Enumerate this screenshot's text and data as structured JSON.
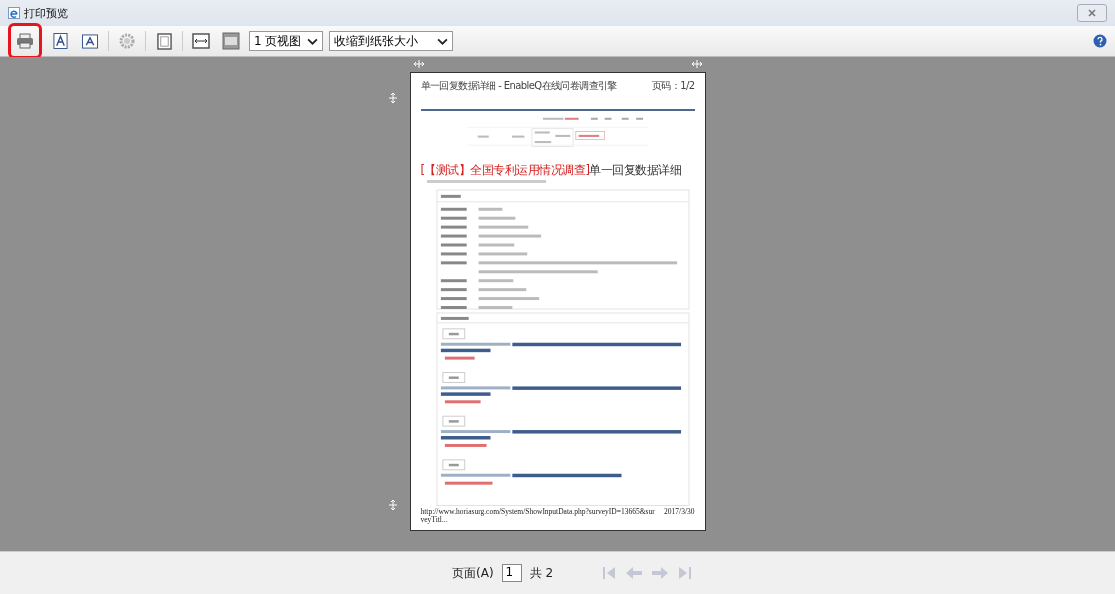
{
  "window": {
    "title": "打印预览"
  },
  "toolbar": {
    "view_select": "1 页视图",
    "scale_select": "收缩到纸张大小"
  },
  "page": {
    "header_title": "单一回复数据详细 - EnableQ在线问卷调查引擎",
    "page_number": "页码：1/2",
    "heading": {
      "highlight": "[【测试】全国专利运用情况调查]",
      "rest": "单一回复数据详细"
    },
    "footer_url": "http://www.horiasurg.com/System/ShowInputData.php?surveyID=13665&surveyTitl...",
    "footer_date": "2017/3/30"
  },
  "pager": {
    "label": "页面(A)",
    "value": "1",
    "total": "共 2"
  }
}
